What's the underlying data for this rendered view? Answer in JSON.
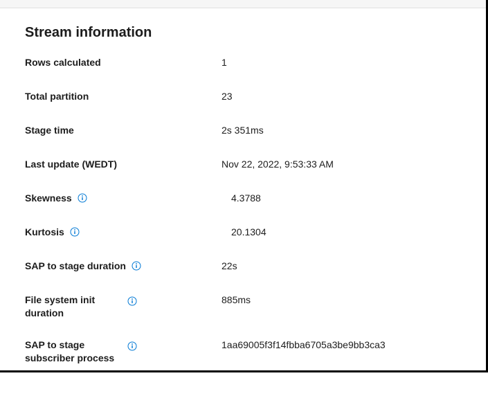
{
  "section": {
    "title": "Stream information"
  },
  "rows": {
    "rowsCalculated": {
      "label": "Rows calculated",
      "value": "1"
    },
    "totalPartition": {
      "label": "Total partition",
      "value": "23"
    },
    "stageTime": {
      "label": "Stage time",
      "value": "2s 351ms"
    },
    "lastUpdate": {
      "label": "Last update (WEDT)",
      "value": "Nov 22, 2022, 9:53:33 AM"
    },
    "skewness": {
      "label": "Skewness",
      "value": "4.3788"
    },
    "kurtosis": {
      "label": "Kurtosis",
      "value": "20.1304"
    },
    "sapToStageDuration": {
      "label": "SAP to stage duration",
      "value": "22s"
    },
    "fsInitDuration": {
      "label": "File system init duration",
      "value": "885ms"
    },
    "sapToStageSubscriber": {
      "label": "SAP to stage subscriber process",
      "value": "1aa69005f3f14fbba6705a3be9bb3ca3"
    }
  }
}
